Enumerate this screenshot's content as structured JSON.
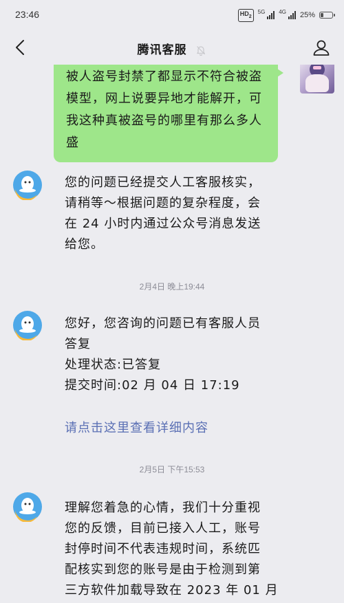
{
  "status_bar": {
    "time": "23:46",
    "hd": "HD",
    "hd_sub": "2",
    "net1": "5G",
    "net2": "4G",
    "battery": "25%",
    "battery_level": 0.25
  },
  "nav": {
    "title": "腾讯客服"
  },
  "messages": {
    "user_message": {
      "lines": [
        "被人盗号封禁了都显示不符合被盗",
        "模型，网上说要异地才能解开，可",
        "我这种真被盗号的哪里有那么多人",
        "盛"
      ]
    },
    "bot1": {
      "lines": [
        "您的问题已经提交人工客服核实，",
        "请稍等～根据问题的复杂程度，会",
        "在 24 小时内通过公众号消息发送",
        "给您。"
      ]
    },
    "timestamp1": "2月4日 晚上19:44",
    "bot2": {
      "lines": [
        "您好，您咨询的问题已有客服人员",
        "答复",
        "处理状态:已答复",
        "提交时间:02 月 04 日 17:19"
      ],
      "link": "请点击这里查看详细内容"
    },
    "timestamp2": "2月5日 下午15:53",
    "bot3": {
      "lines": [
        "理解您着急的心情，我们十分重视",
        "您的反馈，目前已接入人工，账号",
        "封停时间不代表违规时间，系统匹",
        "配核实到您的账号是由于检测到第",
        "三方软件加载导致在 2023 年 01 月"
      ]
    }
  }
}
